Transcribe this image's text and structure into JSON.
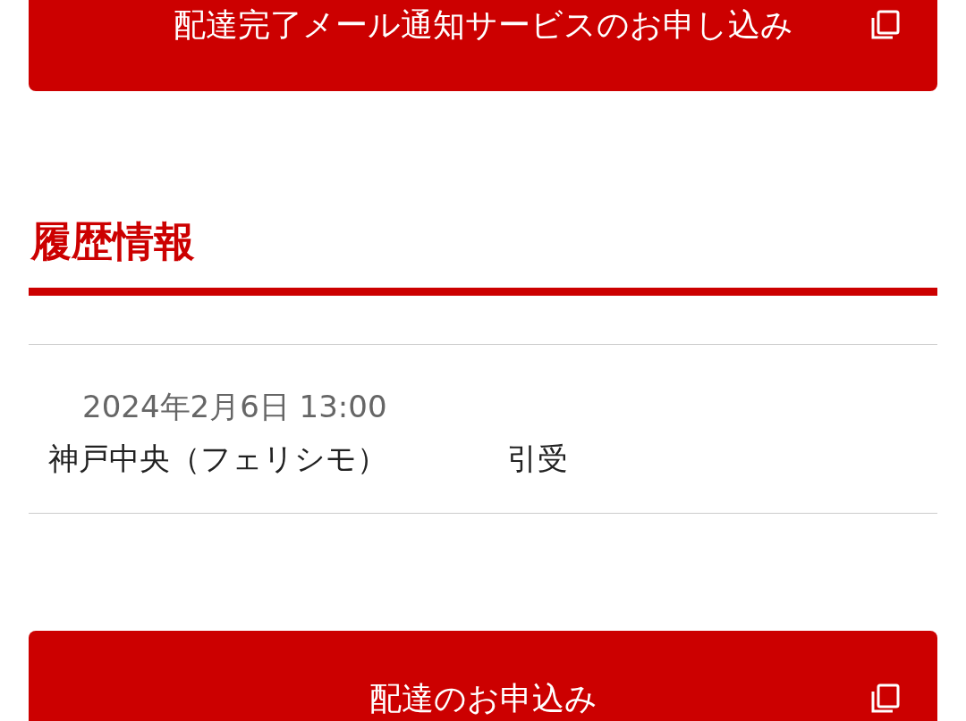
{
  "top_button": {
    "label": "配達完了メール通知サービスのお申し込み"
  },
  "section": {
    "title": "履歴情報"
  },
  "history": [
    {
      "datetime": "2024年2月6日 13:00",
      "location": "神戸中央（フェリシモ）",
      "status": "引受"
    }
  ],
  "bottom_button": {
    "label": "配達のお申込み"
  }
}
